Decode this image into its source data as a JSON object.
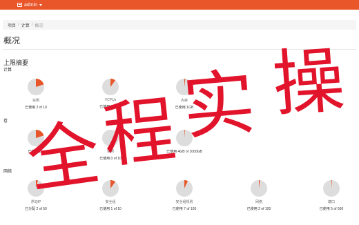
{
  "header": {
    "user": "admin"
  },
  "breadcrumb": {
    "items": [
      "项目",
      "计算"
    ],
    "current": "概况"
  },
  "page": {
    "title": "概况",
    "section_title": "上限摘要"
  },
  "colors": {
    "accent": "#e9562a",
    "pie_used": "#e9562a",
    "pie_free": "#dddddd",
    "watermark": "#e2142c"
  },
  "groups": [
    {
      "title": "计算",
      "items": [
        {
          "label": "实例",
          "usage": "已使用 2 of 10",
          "used": 2,
          "total": 10
        },
        {
          "label": "VCPUs",
          "usage": "已使用 2 of 20",
          "used": 2,
          "total": 20
        },
        {
          "label": "内存",
          "usage": "已使用 1GB",
          "used": 1,
          "total": 50
        }
      ]
    },
    {
      "title": "卷",
      "items": [
        {
          "label": "",
          "usage": "已使用 2 o",
          "used": 2,
          "total": 10
        },
        {
          "label": "快照",
          "usage": "已使用 0 of 10",
          "used": 0,
          "total": 10
        },
        {
          "label": "",
          "usage": "已使用 4GB of 1000GB",
          "used": 4,
          "total": 1000
        }
      ]
    },
    {
      "title": "网络",
      "items": [
        {
          "label": "浮动IP",
          "usage": "已分配 2 of 50",
          "used": 2,
          "total": 50
        },
        {
          "label": "安全组",
          "usage": "已使用 1 of 10",
          "used": 1,
          "total": 10
        },
        {
          "label": "安全组规则",
          "usage": "已使用 7 of 100",
          "used": 7,
          "total": 100
        },
        {
          "label": "网络",
          "usage": "已使用 2 of 100",
          "used": 2,
          "total": 100
        },
        {
          "label": "端口",
          "usage": "已使用 5 of 500",
          "used": 5,
          "total": 500
        }
      ]
    }
  ],
  "watermark": {
    "text": "全程实操"
  }
}
